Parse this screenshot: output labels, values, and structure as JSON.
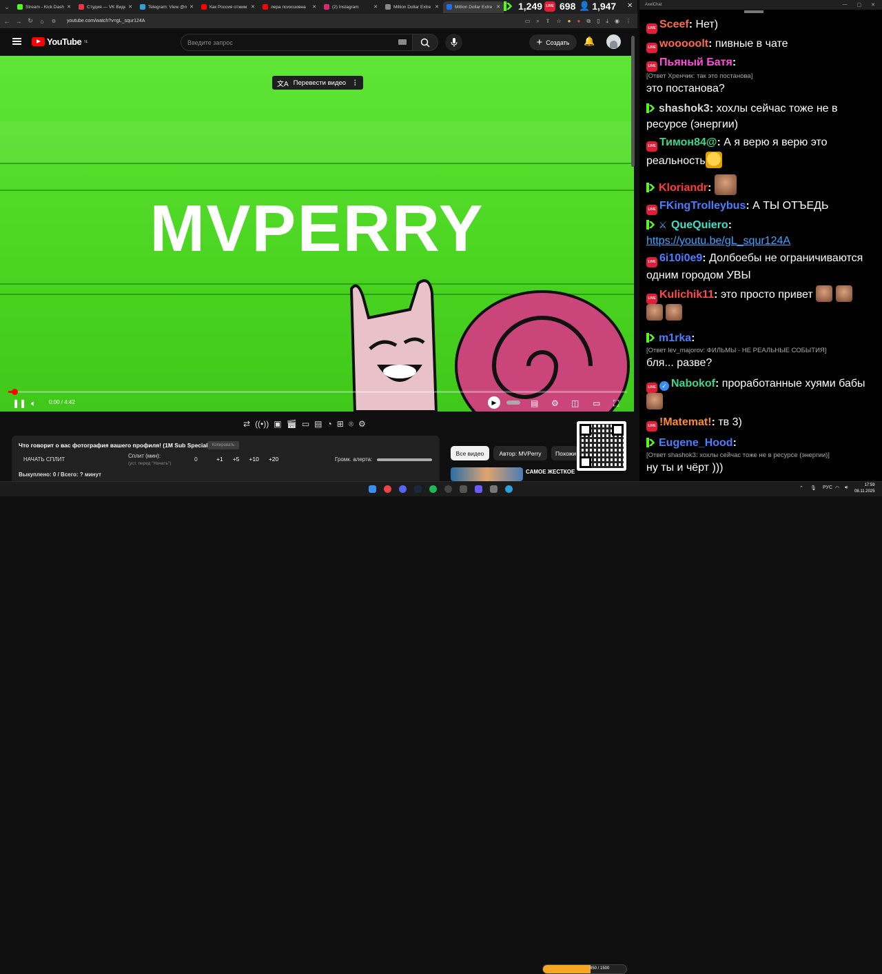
{
  "browser": {
    "tabs": [
      {
        "label": "Stream - Kick Dash",
        "color": "#53fc18"
      },
      {
        "label": "Студия — VK Видео",
        "color": "#e5364a"
      },
      {
        "label": "Telegram: View @m",
        "color": "#2aa1da"
      },
      {
        "label": "Как Россия отжим",
        "color": "#ff0000"
      },
      {
        "label": "лера психозовна",
        "color": "#ff0000"
      },
      {
        "label": "(2) Instagram",
        "color": "#d62976"
      },
      {
        "label": "Million Dollar Extre",
        "color": "#888888"
      },
      {
        "label": "Million Dollar Extre",
        "color": "#1f6feb",
        "active": true
      }
    ],
    "url": "youtube.com/watch?v=gL_squr124A"
  },
  "counters": {
    "kick": "1,249",
    "vk": "698",
    "viewers": "1,947"
  },
  "youtube": {
    "logo": "YouTube",
    "region": "NL",
    "search_placeholder": "Введите запрос",
    "create_label": "Создать"
  },
  "video": {
    "title_text": "MVPERRY",
    "translate_label": "Перевести видео",
    "time": "0:00 / 4:42",
    "progress": 0.01
  },
  "panel": {
    "title": "Что говорит о вас фотография вашего профиля! (1M Sub Special)",
    "btn": "Копировать",
    "start_split": "НАЧАТЬ СПЛИТ",
    "split_label": "Сплит (мин):",
    "split_hint": "(уст. перед \"Начать\")",
    "split_value": "0",
    "steps": [
      "+1",
      "+5",
      "+10",
      "+20"
    ],
    "volume_label": "Громк. алерта:",
    "bought": "Выкуплено: 0 / Всего: ? минут"
  },
  "recs": {
    "chips": [
      "Все видео",
      "Автор: MVPerry",
      "Похожи"
    ],
    "first_title": "САМОЕ ЖЕСТКОЕ"
  },
  "chat": {
    "window_title": "AxelChat",
    "messages": [
      {
        "src": "live",
        "user": "Sceef",
        "color": "#ff6b4a",
        "text": "Нет)"
      },
      {
        "src": "live",
        "user": "wooooolt",
        "color": "#ff6b4a",
        "text": "пивные в чате"
      },
      {
        "src": "live",
        "user": "Пьяный Батя",
        "color": "#ff4fd8",
        "reply": "[Ответ Хренчик: так это постанова]",
        "text": "это постанова?"
      },
      {
        "src": "kick",
        "user": "shashok3",
        "color": "#d9d9d9",
        "text": "хохлы сейчас тоже не в ресурсе (энергии)"
      },
      {
        "src": "live",
        "user": "Тимон84@",
        "color": "#3dd68c",
        "text": "А я верю я верю это реальность"
      },
      {
        "src": "kick",
        "user": "Kloriandr",
        "color": "#ff3b3b",
        "text": ""
      },
      {
        "src": "live",
        "user": "FKingTrolleybus",
        "color": "#4f7dff",
        "text": "А ТЫ ОТЪЕДЬ"
      },
      {
        "src": "kick",
        "user": "QueQuiero",
        "color": "#3ee0c8",
        "text": "https://youtu.be/gL_squr124A"
      },
      {
        "src": "live",
        "user": "6i10i0e9",
        "color": "#4f7dff",
        "text": "Долбоебы не ограничиваются одним городом УВЫ"
      },
      {
        "src": "live",
        "user": "Kulichik11",
        "color": "#ff4a4a",
        "text": "это просто привет"
      },
      {
        "src": "kick",
        "user": "m1rka",
        "color": "#4f7dff",
        "reply": "[Ответ lev_majorov: ФИЛЬМЫ - НЕ РЕАЛЬНЫЕ СОБЫТИЯ]",
        "text": "бля... разве?"
      },
      {
        "src": "live",
        "user": "Nabokof",
        "color": "#3dd68c",
        "text": "проработанные хуями бабы"
      },
      {
        "src": "live",
        "user": "!Matemat!",
        "color": "#ff8c2a",
        "text": "тв 3)"
      },
      {
        "src": "kick",
        "user": "Eugene_Hood",
        "color": "#4f7dff",
        "reply": "[Ответ shashok3: хохлы сейчас тоже не в ресурсе (энергии)]",
        "text": "ну ты и чёрт )))"
      }
    ]
  },
  "taskbar": {
    "lang": "РУС",
    "time": "17:59",
    "date": "08.11.2025",
    "goal": "850 / 1500",
    "goal_fraction": 0.57
  }
}
